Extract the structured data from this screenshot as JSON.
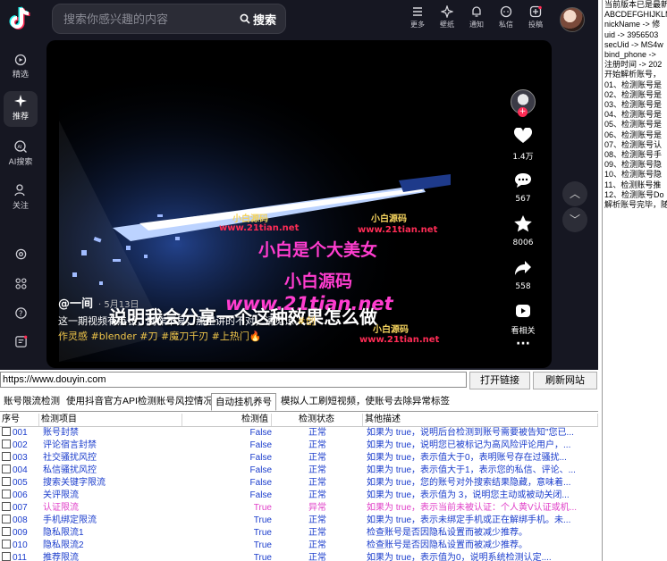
{
  "browser": {
    "search_placeholder": "搜索你感兴趣的内容",
    "search_button": "搜索",
    "top_icons": [
      {
        "icon": "more-icon",
        "label": "更多"
      },
      {
        "icon": "wallpaper-icon",
        "label": "壁纸"
      },
      {
        "icon": "bell-icon",
        "label": "通知"
      },
      {
        "icon": "message-icon",
        "label": "私信"
      },
      {
        "icon": "upload-icon",
        "label": "投稿"
      }
    ],
    "sidebar": [
      "精选",
      "推荐",
      "AI搜索",
      "关注"
    ],
    "video": {
      "overlay_lines": [
        "小白是个大美女",
        "小白源码",
        "www.21tian.net"
      ],
      "watermark_small": "小白源码",
      "watermark_url": "www.21tian.net",
      "subtitle": "说明我会分享一个这种效果怎么做",
      "author": "@一间",
      "date": "· 5月13日",
      "desc_text": "这一期视频有点长，制作不易，那里讲的不对，请见谅 ",
      "tags": "#创作灵感  #blender  #刀  #魔刀千刃  #上热门🔥"
    },
    "actions": [
      {
        "icon": "heart-icon",
        "count": "1.4万"
      },
      {
        "icon": "comment-icon",
        "count": "567"
      },
      {
        "icon": "star-icon",
        "count": "8006"
      },
      {
        "icon": "share-icon",
        "count": "558"
      },
      {
        "icon": "play-related-icon",
        "count": "看相关"
      }
    ]
  },
  "tool": {
    "url": "https://www.douyin.com",
    "open_button": "打开链接",
    "refresh_button": "刷新网站",
    "tabs": [
      "账号限流检测",
      "使用抖音官方API检测账号风控情况",
      "自动挂机养号",
      "模拟人工刷短视频，使账号去除异常标签"
    ],
    "active_tab": 2,
    "columns": [
      "序号",
      "检测项目",
      "检测值",
      "检测状态",
      "其他描述"
    ],
    "rows": [
      [
        "001",
        "账号封禁",
        "False",
        "正常",
        "如果为 true，说明后台检测到账号需要被告知\"您已..."
      ],
      [
        "002",
        "评论宿言封禁",
        "False",
        "正常",
        "如果为 true，说明您已被标记为高风险评论用户，..."
      ],
      [
        "003",
        "社交骚扰风控",
        "False",
        "正常",
        "如果为 true，表示值大于0，表明账号存在过骚扰..."
      ],
      [
        "004",
        "私信骚扰风控",
        "False",
        "正常",
        "如果为 true，表示值大于1，表示您的私信、评论、..."
      ],
      [
        "005",
        "搜索关键字限流",
        "False",
        "正常",
        "如果为 true，您的账号对外搜索结果隐藏，意味着..."
      ],
      [
        "006",
        "关评限流",
        "False",
        "正常",
        "如果为 true，表示值为 3，说明您主动或被动关闭..."
      ],
      [
        "007",
        "认证限流",
        "True",
        "异常",
        "如果为 true，表示当前未被认证：个人黄V认证或机..."
      ],
      [
        "008",
        "手机绑定限流",
        "True",
        "正常",
        "如果为 true，表示未绑定手机或正在解绑手机。未..."
      ],
      [
        "009",
        "隐私限流1",
        "True",
        "正常",
        "检查账号是否因隐私设置而被减少推荐。"
      ],
      [
        "010",
        "隐私限流2",
        "True",
        "正常",
        "检查账号是否因隐私设置而被减少推荐。"
      ],
      [
        "011",
        "推荐限流",
        "True",
        "正常",
        "如果为 true，表示值为0，说明系统检测认定...."
      ]
    ]
  },
  "log": [
    "当前版本已是最新版",
    "ABCDEFGHIJKLMN",
    "nickName -> 修",
    "uid -> 3956503",
    "secUid -> MS4w",
    "bind_phone ->",
    "注册时间 -> 202",
    "开始解析账号，",
    "01、检测账号是",
    "02、检测账号是",
    "03、检测账号是",
    "04、检测账号是",
    "05、检测账号是",
    "06、检测账号是",
    "07、检测账号认",
    "08、检测账号手",
    "09、检测账号隐",
    "10、检测账号隐",
    "11、检测账号推",
    "12、检测账号Do",
    "解析账号完毕，随"
  ],
  "colors": {
    "accent_red": "#fe2c55",
    "abnormal": "#e040c8",
    "ok_blue": "#1a3ccc",
    "tag_gold": "#f0c64a"
  }
}
